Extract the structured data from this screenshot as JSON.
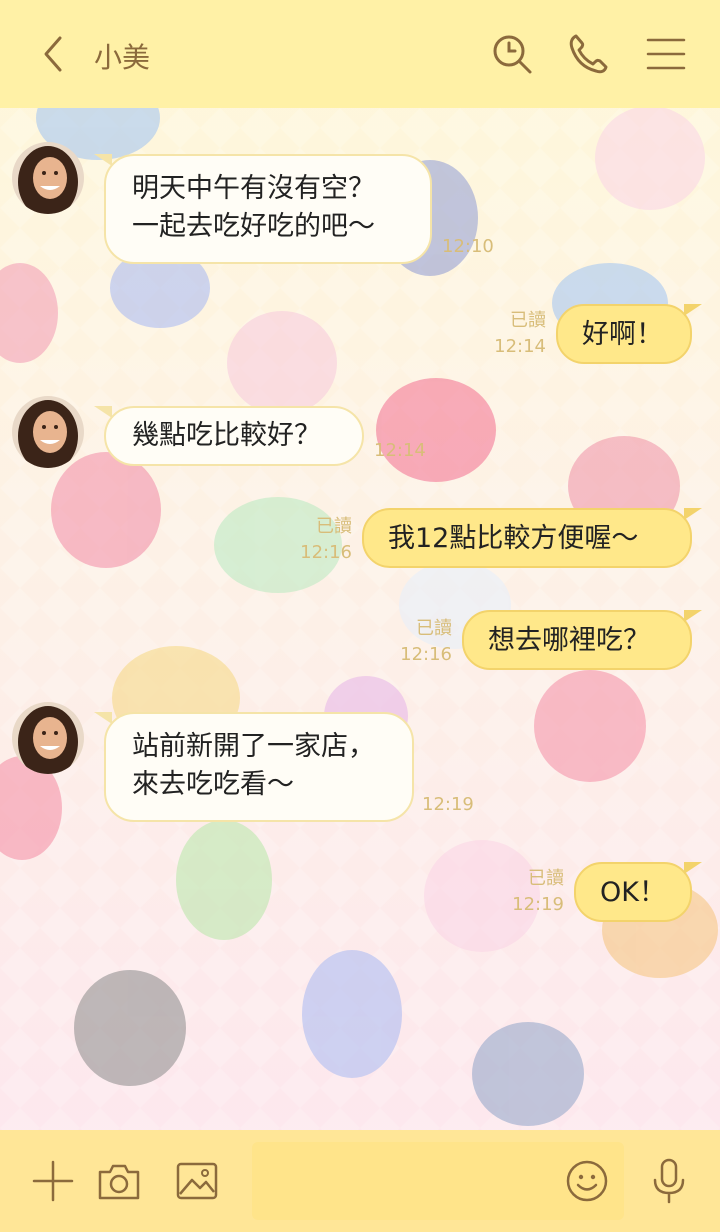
{
  "header": {
    "title": "小美",
    "back_icon": "chevron-left-icon",
    "search_icon": "search-clock-icon",
    "call_icon": "phone-icon",
    "menu_icon": "hamburger-menu-icon",
    "bg_color": "#fff1a6",
    "icon_color": "#8b6a3c"
  },
  "messages": [
    {
      "side": "in",
      "text": "明天中午有沒有空？\n一起去吃好吃的吧～",
      "time": "12:10"
    },
    {
      "side": "out",
      "text": "好啊！",
      "read": "已讀",
      "time": "12:14"
    },
    {
      "side": "in",
      "text": "幾點吃比較好？",
      "time": "12:14"
    },
    {
      "side": "out",
      "text": "我12點比較方便喔～",
      "read": "已讀",
      "time": "12:16"
    },
    {
      "side": "out",
      "text": "想去哪裡吃？",
      "read": "已讀",
      "time": "12:16"
    },
    {
      "side": "in",
      "text": "站前新開了一家店，\n來去吃吃看～",
      "time": "12:19"
    },
    {
      "side": "out",
      "text": "OK！",
      "read": "已讀",
      "time": "12:19"
    }
  ],
  "footer": {
    "add_icon": "plus-icon",
    "camera_icon": "camera-icon",
    "image_icon": "image-icon",
    "emoji_icon": "smiley-icon",
    "mic_icon": "microphone-icon",
    "input_value": "",
    "bg_color": "#ffe697"
  },
  "colors": {
    "incoming_bubble": "#fffdf6",
    "outgoing_bubble": "#ffe88a",
    "meta_text": "#d8bd79"
  }
}
